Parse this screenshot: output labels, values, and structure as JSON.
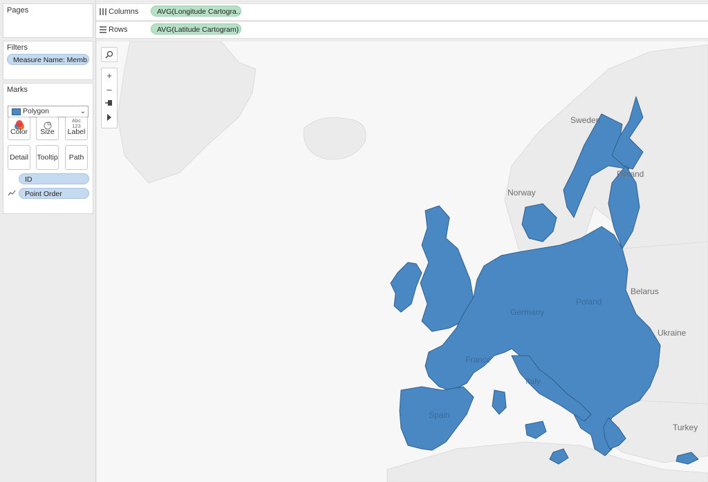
{
  "shelves": {
    "columns": {
      "label": "Columns",
      "pill": "AVG(Longitude Cartogra.."
    },
    "rows": {
      "label": "Rows",
      "pill": "AVG(Latitude Cartogram)"
    }
  },
  "pages": {
    "title": "Pages"
  },
  "filters": {
    "title": "Filters",
    "pill": "Measure Name: Memb.."
  },
  "marks": {
    "title": "Marks",
    "mark_type": "Polygon",
    "buttons": {
      "color": "Color",
      "size": "Size",
      "label": "Label",
      "label_icon_top": "Abc",
      "label_icon_bottom": "123",
      "detail": "Detail",
      "tooltip": "Tooltip",
      "path": "Path"
    },
    "fields": {
      "id": "ID",
      "point_order": "Point Order"
    }
  },
  "map": {
    "labels": {
      "sweden": "Sweden",
      "finland": "Finland",
      "norway": "Norway",
      "belarus": "Belarus",
      "ukraine": "Ukraine",
      "turkey": "Turkey",
      "germany": "Germany",
      "poland": "Poland",
      "france": "France",
      "italy": "Italy",
      "spain": "Spain"
    },
    "colors": {
      "polygon_fill": "#4a88c4",
      "polygon_stroke": "#2f5f8c",
      "land": "#eaeaea",
      "background": "#f7f7f7"
    }
  }
}
